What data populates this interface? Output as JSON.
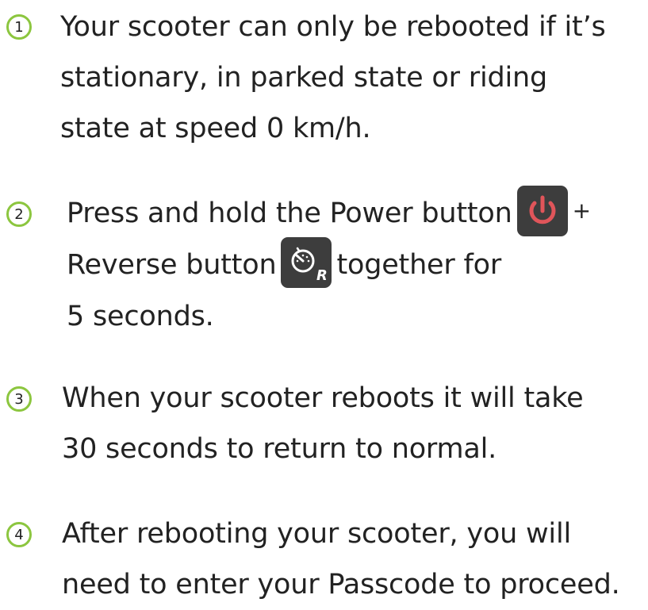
{
  "colors": {
    "badge_border": "#8cc63f",
    "text": "#222222",
    "button_bg": "#3d3d3d",
    "power_icon": "#e0555a"
  },
  "steps": [
    {
      "number": "1",
      "lines": [
        "Your scooter can only be rebooted if it’s",
        "stationary, in parked state or riding",
        "state at speed 0 km/h."
      ]
    },
    {
      "number": "2",
      "line1_text": "Press and hold the Power button",
      "line1_plus": "+",
      "line2_text_before": "Reverse button",
      "line2_text_after": "together for",
      "line3": "5 seconds.",
      "power_icon": "power-icon",
      "reverse_icon": "speedometer-reverse-icon",
      "reverse_letter": "R"
    },
    {
      "number": "3",
      "lines": [
        "When your scooter reboots it will take",
        "30 seconds to return to normal."
      ]
    },
    {
      "number": "4",
      "lines": [
        "After rebooting your scooter, you will",
        "need to enter your Passcode to proceed."
      ]
    }
  ]
}
